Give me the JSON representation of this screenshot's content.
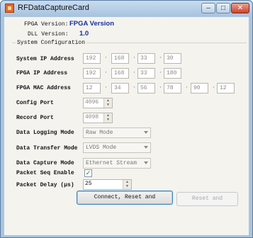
{
  "window": {
    "title": "RFDataCaptureCard",
    "min_glyph": "–",
    "max_glyph": "□",
    "close_glyph": "✕"
  },
  "versions": {
    "fpga_label": "FPGA Version:",
    "fpga_value": "FPGA Version",
    "dll_label": "DLL Version:",
    "dll_value": "1.0"
  },
  "system_config": {
    "group_label": "System Configuration",
    "system_ip": {
      "label": "System IP Address",
      "octets": [
        "192",
        "168",
        "33",
        "30"
      ]
    },
    "fpga_ip": {
      "label": "FPGA IP Address",
      "octets": [
        "192",
        "168",
        "33",
        "180"
      ]
    },
    "fpga_mac": {
      "label": "FPGA MAC Address",
      "bytes": [
        "12",
        "34",
        "56",
        "78",
        "90",
        "12"
      ]
    },
    "config_port": {
      "label": "Config Port",
      "value": "4096"
    },
    "record_port": {
      "label": "Record Port",
      "value": "4098"
    },
    "data_logging_mode": {
      "label": "Data Logging Mode",
      "value": "Raw Mode"
    },
    "data_transfer_mode": {
      "label": "Data Transfer Mode",
      "value": "LVDS Mode"
    },
    "data_capture_mode": {
      "label": "Data Capture Mode",
      "value": "Ethernet Stream"
    },
    "packet_seq_enable": {
      "label": "Packet Seq Enable",
      "checked": true,
      "mark": "✓"
    },
    "packet_delay": {
      "label": "Packet Delay (µs)",
      "value": "25"
    }
  },
  "buttons": {
    "connect_label": "Connect, Reset and",
    "reset_label": "Reset and"
  },
  "colors": {
    "accent": "#1a2e9e",
    "window_frame": "#a9c4de"
  }
}
